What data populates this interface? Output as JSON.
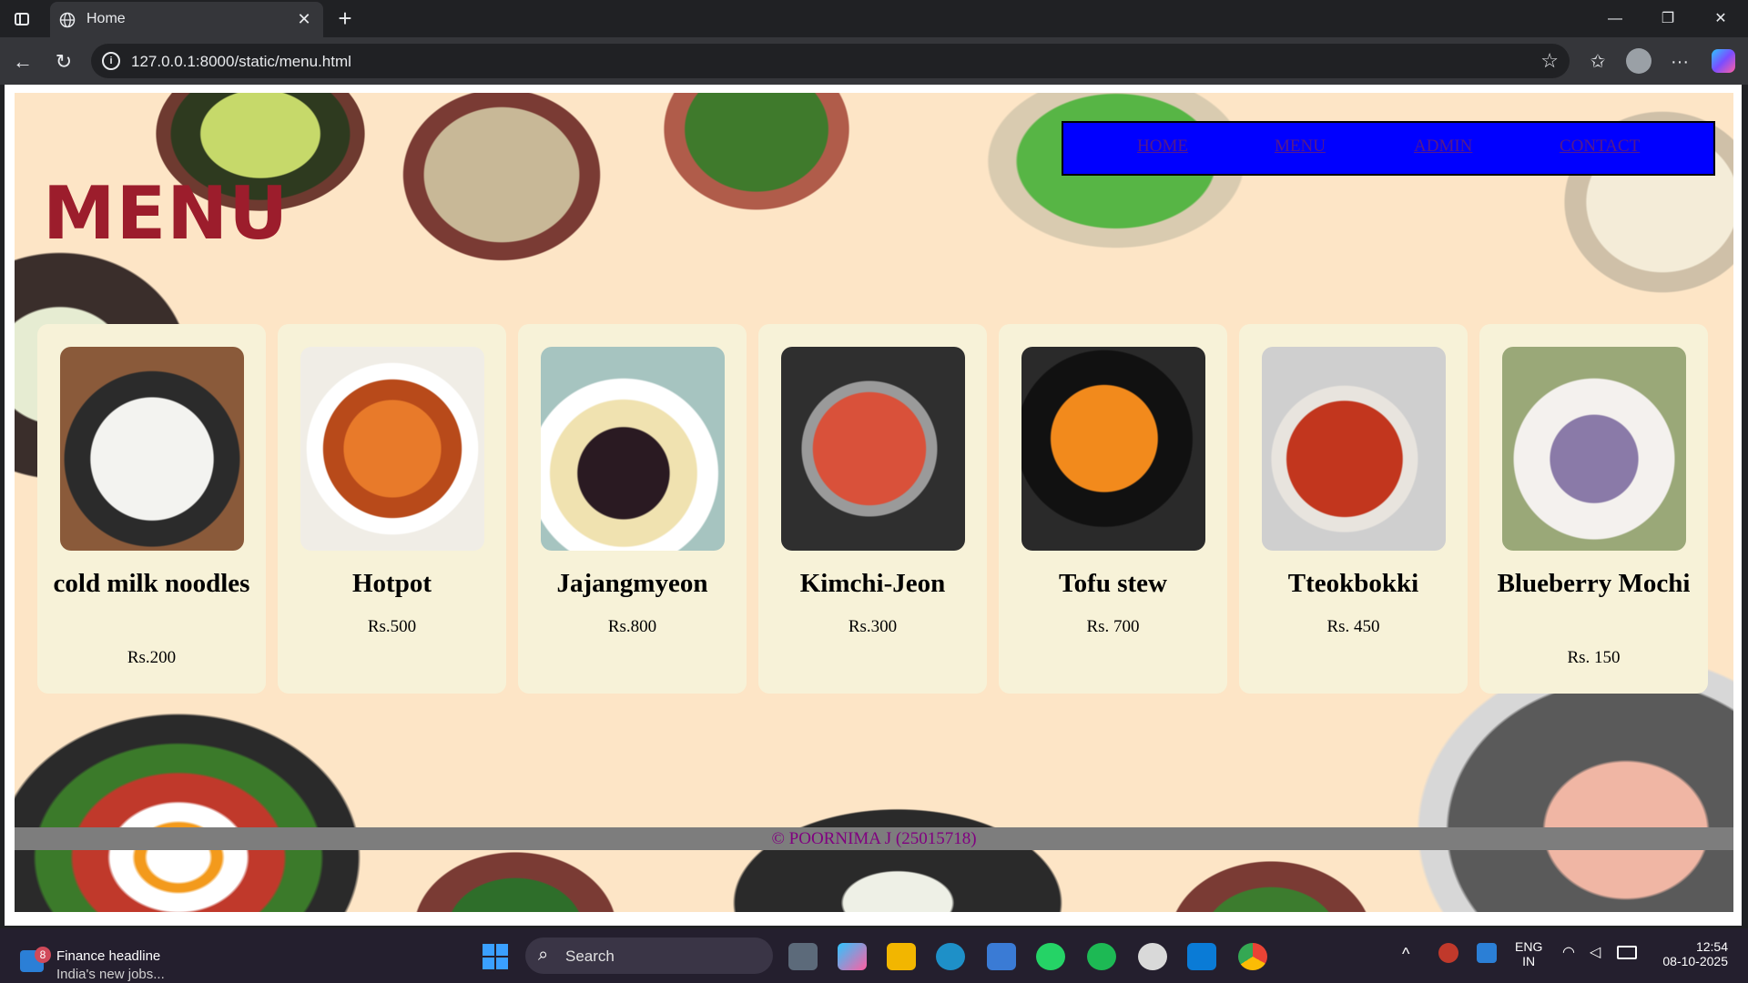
{
  "browser": {
    "tab_title": "Home",
    "url": "127.0.0.1:8000/static/menu.html",
    "new_tab": "+",
    "close_tab": "✕"
  },
  "page": {
    "heading": "MENU",
    "nav": [
      "HOME",
      "MENU",
      "ADMIN",
      "CONTACT"
    ],
    "items": [
      {
        "name": "cold milk noodles",
        "price": "Rs.200"
      },
      {
        "name": "Hotpot",
        "price": "Rs.500"
      },
      {
        "name": "Jajangmyeon",
        "price": "Rs.800"
      },
      {
        "name": "Kimchi-Jeon",
        "price": "Rs.300"
      },
      {
        "name": "Tofu stew",
        "price": "Rs. 700"
      },
      {
        "name": "Tteokbokki",
        "price": "Rs. 450"
      },
      {
        "name": "Blueberry Mochi",
        "price": "Rs. 150"
      }
    ],
    "footer": "© POORNIMA J (25015718)",
    "colors": {
      "heading": "#9c1d2c",
      "nav_bg": "#0000ff",
      "card_bg": "#f7f2d8",
      "page_bg": "#fde5c6",
      "footer_text": "#800080"
    }
  },
  "taskbar": {
    "news_title": "Finance headline",
    "news_sub": "India's new jobs...",
    "news_badge": "8",
    "search_label": "Search",
    "lang_top": "ENG",
    "lang_bottom": "IN",
    "time": "12:54",
    "date": "08-10-2025"
  }
}
